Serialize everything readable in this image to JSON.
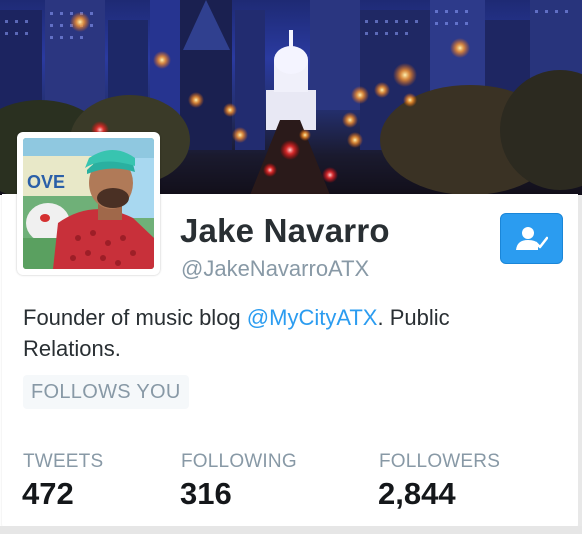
{
  "profile": {
    "name": "Jake Navarro",
    "handle": "@JakeNavarroATX",
    "bio_prefix": "Founder of music blog ",
    "bio_link": "@MyCityATX",
    "bio_suffix": ". Public Relations.",
    "follows_you": "FOLLOWS YOU"
  },
  "stats": {
    "tweets_label": "TWEETS",
    "tweets_value": "472",
    "following_label": "FOLLOWING",
    "following_value": "316",
    "followers_label": "FOLLOWERS",
    "followers_value": "2,844"
  },
  "icons": {
    "follow_button": "user-following-icon"
  },
  "colors": {
    "link": "#2b9cf0",
    "button": "#2b9cf0",
    "muted": "#8899a6",
    "text": "#292f33"
  }
}
